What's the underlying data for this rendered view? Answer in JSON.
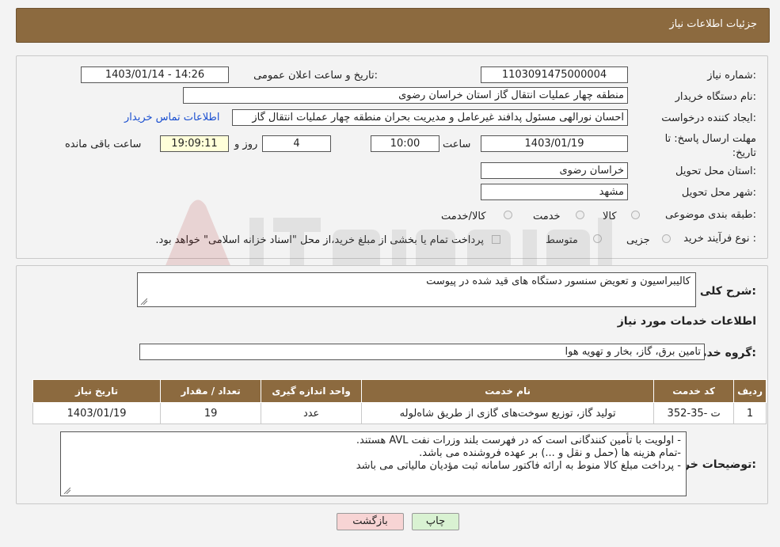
{
  "header": {
    "title": "جزئیات اطلاعات نیاز"
  },
  "form": {
    "need_number_label": "شماره نیاز:",
    "need_number": "1103091475000004",
    "announce_label": "تاریخ و ساعت اعلان عمومی:",
    "announce_value": "1403/01/14 - 14:26",
    "buyer_org_label": "نام دستگاه خریدار:",
    "buyer_org": "منطقه چهار عملیات انتقال گاز    استان خراسان رضوی",
    "creator_label": "ایجاد کننده درخواست:",
    "creator": "احسان نورالهی مسئول پدافند غیرعامل و مدیریت بحران منطقه چهار عملیات انتقال گاز",
    "contact_link": "اطلاعات تماس خریدار",
    "deadline_label": "مهلت ارسال پاسخ: تا تاریخ:",
    "deadline_date": "1403/01/19",
    "time_label": "ساعت",
    "deadline_time": "10:00",
    "days_value": "4",
    "days_label": "روز و",
    "remaining_time": "19:09:11",
    "remaining_label": "ساعت باقی مانده",
    "province_label": "استان محل تحویل:",
    "province": "خراسان رضوی",
    "city_label": "شهر محل تحویل:",
    "city": "مشهد",
    "category_label": "طبقه بندی موضوعی:",
    "category_options": [
      "کالا",
      "خدمت",
      "کالا/خدمت"
    ],
    "process_label": "نوع فرآیند خرید :",
    "process_options": [
      "جزیی",
      "متوسط"
    ],
    "payment_note": "پرداخت تمام یا بخشی از مبلغ خرید،از محل \"اسناد خزانه اسلامی\" خواهد بود."
  },
  "details": {
    "summary_label": "شرح کلی نیاز:",
    "summary": "کالیبراسیون و تعویض سنسور دستگاه های قید شده در پیوست",
    "services_title": "اطلاعات خدمات مورد نیاز",
    "group_label": "گروه خدمت:",
    "group": "تامین برق، گاز، بخار و تهویه هوا",
    "table": {
      "headers": [
        "ردیف",
        "کد خدمت",
        "نام خدمت",
        "واحد اندازه گیری",
        "تعداد / مقدار",
        "تاریخ نیاز"
      ],
      "rows": [
        [
          "1",
          "ت -35-352",
          "تولید گاز، توزیع سوخت‌های گازی از طریق شاه‌لوله",
          "عدد",
          "19",
          "1403/01/19"
        ]
      ]
    },
    "buyer_notes_label": "توضیحات خریدار:",
    "buyer_notes": [
      "- اولویت با تأمین کنندگانی است که در فهرست بلند وزرات نفت AVL هستند.",
      "-تمام هزینه ها (حمل و نقل و ...) بر عهده فروشنده می باشد.",
      "- پرداخت مبلغ کالا منوط به ارائه فاکتور سامانه ثبت مؤدیان مالیاتی می باشد"
    ]
  },
  "buttons": {
    "print": "چاپ",
    "back": "بازگشت"
  },
  "colors": {
    "header_bg": "#8c6a3f",
    "link": "#1a4fd0",
    "back_btn": "#f7d4d4",
    "print_btn": "#d9f2d2"
  }
}
